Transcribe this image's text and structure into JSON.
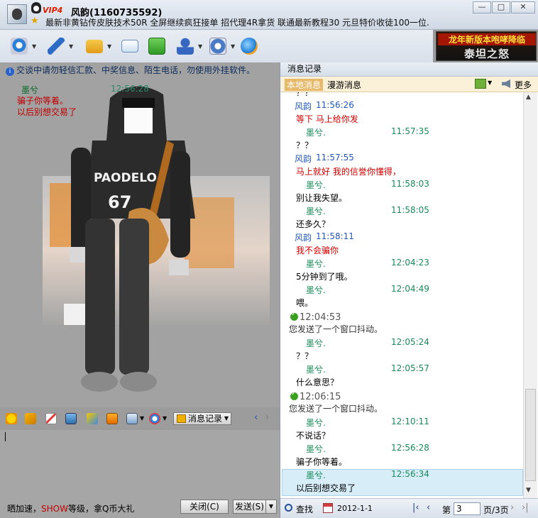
{
  "window": {
    "vip": "VIP4",
    "contact_name": "风韵(1160735592)",
    "signature": "最新非黄钻传皮肤技术50R 全屏继续疯狂接单 招代理4R拿货 联通最新教程30 元旦特价收徒100一位."
  },
  "window_buttons": [
    "—",
    "□",
    "✕"
  ],
  "banner": {
    "line1": "龙年新版本咆哮降临",
    "line2": "泰坦之怒"
  },
  "chat": {
    "notice": "交谈中请勿轻信汇款、中奖信息、陌生电话，勿使用外挂软件。",
    "messages": [
      {
        "sender": "墨兮",
        "time": "12:56:28",
        "text": "骗子你等着。"
      },
      {
        "sender": "",
        "time": "",
        "text": "以后别想交易了"
      }
    ]
  },
  "photo": {
    "hoodie_text": "PAODELO",
    "hoodie_number": "67"
  },
  "input_toolbar": {
    "history_label": "消息记录"
  },
  "bottom": {
    "promo_prefix": "晒加速，",
    "promo_show": "SHOW",
    "promo_suffix": "等级，拿Q币大礼",
    "close_label": "关闭(C)",
    "send_label": "发送(S)"
  },
  "history_panel": {
    "title": "消息记录",
    "tab_local": "本地消息",
    "tab_roam": "漫游消息",
    "more_label": "更多",
    "entries": [
      {
        "kind": "text",
        "color": "black",
        "text": "？？"
      },
      {
        "kind": "header",
        "sender": "风韵",
        "time": "11:56:26"
      },
      {
        "kind": "text",
        "color": "red",
        "text": "等下  马上给你发"
      },
      {
        "kind": "header2",
        "sender": "墨兮.",
        "time": "11:57:35"
      },
      {
        "kind": "text",
        "color": "black",
        "text": "？？"
      },
      {
        "kind": "header",
        "sender": "风韵",
        "time": "11:57:55"
      },
      {
        "kind": "text",
        "color": "red",
        "text": "马上就好  我的信誉你懂得，"
      },
      {
        "kind": "header2",
        "sender": "墨兮.",
        "time": "11:58:03"
      },
      {
        "kind": "text",
        "color": "black",
        "text": "别让我失望。"
      },
      {
        "kind": "header2",
        "sender": "墨兮.",
        "time": "11:58:05"
      },
      {
        "kind": "text",
        "color": "black",
        "text": "还多久？"
      },
      {
        "kind": "header",
        "sender": "风韵",
        "time": "11:58:11"
      },
      {
        "kind": "text",
        "color": "red",
        "text": "我不会骗你"
      },
      {
        "kind": "header2",
        "sender": "墨兮.",
        "time": "12:04:23"
      },
      {
        "kind": "text",
        "color": "black",
        "text": "5分钟到了哦。"
      },
      {
        "kind": "header2",
        "sender": "墨兮.",
        "time": "12:04:49"
      },
      {
        "kind": "text",
        "color": "black",
        "text": "喂。"
      },
      {
        "kind": "system_time",
        "time": "12:04:53"
      },
      {
        "kind": "system",
        "text": "您发送了一个窗口抖动。"
      },
      {
        "kind": "header2",
        "sender": "墨兮.",
        "time": "12:05:24"
      },
      {
        "kind": "text",
        "color": "black",
        "text": "？？"
      },
      {
        "kind": "header2",
        "sender": "墨兮.",
        "time": "12:05:57"
      },
      {
        "kind": "text",
        "color": "black",
        "text": "什么意思？"
      },
      {
        "kind": "system_time",
        "time": "12:06:15"
      },
      {
        "kind": "system",
        "text": "您发送了一个窗口抖动。"
      },
      {
        "kind": "header2",
        "sender": "墨兮.",
        "time": "12:10:11"
      },
      {
        "kind": "text",
        "color": "black",
        "text": "不说话？"
      },
      {
        "kind": "header2",
        "sender": "墨兮.",
        "time": "12:56:28"
      },
      {
        "kind": "text",
        "color": "black",
        "text": "骗子你等着。"
      },
      {
        "kind": "header2",
        "sender": "墨兮.",
        "time": "12:56:34"
      },
      {
        "kind": "text",
        "color": "black",
        "text": "以后别想交易了"
      }
    ],
    "search_label": "查找",
    "date": "2012-1-1",
    "page_prefix": "第",
    "page_value": "3",
    "page_total": "页/3页"
  }
}
